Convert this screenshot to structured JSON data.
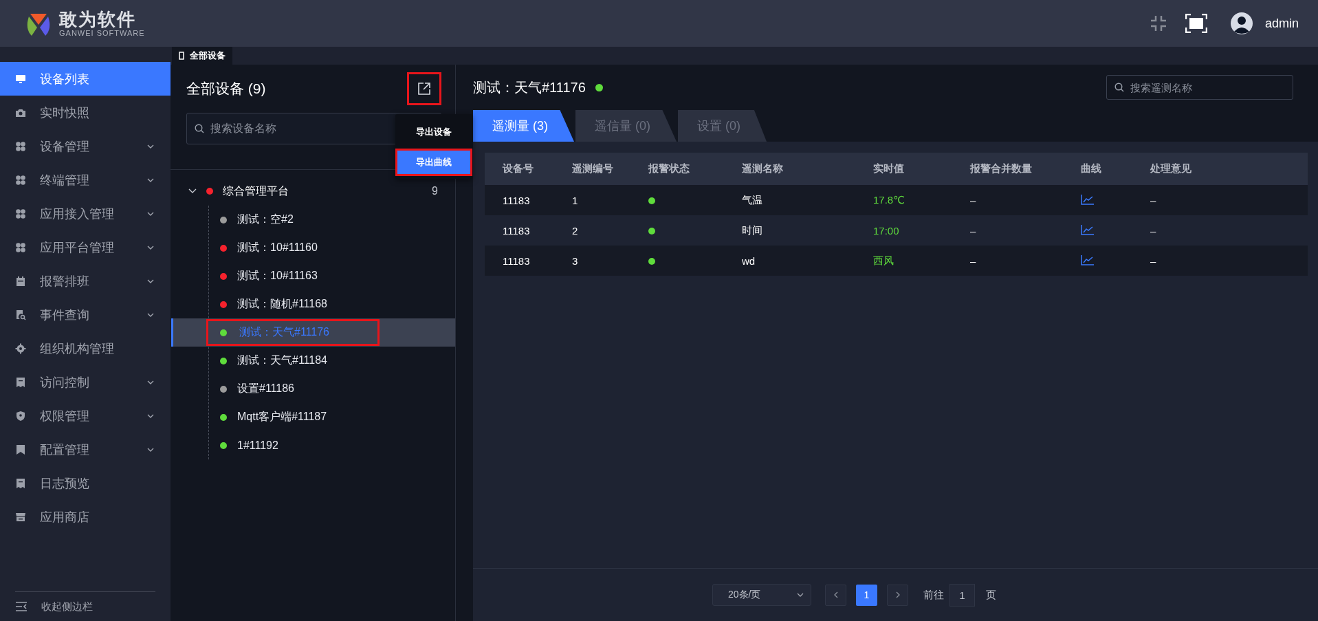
{
  "header": {
    "logo_title": "敢为软件",
    "logo_subtitle": "GANWEI SOFTWARE",
    "user": "admin"
  },
  "sidebar": {
    "items": [
      {
        "label": "设备列表",
        "selected": true,
        "expandable": false
      },
      {
        "label": "实时快照",
        "selected": false,
        "expandable": false
      },
      {
        "label": "设备管理",
        "selected": false,
        "expandable": true
      },
      {
        "label": "终端管理",
        "selected": false,
        "expandable": true
      },
      {
        "label": "应用接入管理",
        "selected": false,
        "expandable": true
      },
      {
        "label": "应用平台管理",
        "selected": false,
        "expandable": true
      },
      {
        "label": "报警排班",
        "selected": false,
        "expandable": true
      },
      {
        "label": "事件查询",
        "selected": false,
        "expandable": true
      },
      {
        "label": "组织机构管理",
        "selected": false,
        "expandable": false
      },
      {
        "label": "访问控制",
        "selected": false,
        "expandable": true
      },
      {
        "label": "权限管理",
        "selected": false,
        "expandable": true
      },
      {
        "label": "配置管理",
        "selected": false,
        "expandable": true
      },
      {
        "label": "日志预览",
        "selected": false,
        "expandable": false
      },
      {
        "label": "应用商店",
        "selected": false,
        "expandable": false
      }
    ],
    "collapse": "收起侧边栏"
  },
  "page_tabs": [
    {
      "label": "全部设备",
      "selected": true
    }
  ],
  "device_panel": {
    "title": "全部设备 (9)",
    "export_highlighted": true,
    "export_menu": [
      {
        "label": "导出设备",
        "selected": false,
        "highlighted": false
      },
      {
        "label": "导出曲线",
        "selected": true,
        "highlighted": true
      }
    ],
    "search": {
      "placeholder": "搜索设备名称"
    },
    "tree": [
      {
        "label": "综合管理平台",
        "color": "#f5222d",
        "count": "9",
        "expanded": true,
        "children": [
          {
            "label": "测试：空#2",
            "color": "#9b9b9b",
            "selected": false,
            "highlighted": false
          },
          {
            "label": "测试：10#11160",
            "color": "#f5222d",
            "selected": false,
            "highlighted": false
          },
          {
            "label": "测试：10#11163",
            "color": "#f5222d",
            "selected": false,
            "highlighted": false
          },
          {
            "label": "测试：随机#11168",
            "color": "#f5222d",
            "selected": false,
            "highlighted": false
          },
          {
            "label": "测试：天气#11176",
            "color": "#5fdc3c",
            "selected": true,
            "highlighted": true
          },
          {
            "label": "测试：天气#11184",
            "color": "#5fdc3c",
            "selected": false,
            "highlighted": false
          },
          {
            "label": "设置#11186",
            "color": "#9b9b9b",
            "selected": false,
            "highlighted": false
          },
          {
            "label": "Mqtt客户端#11187",
            "color": "#5fdc3c",
            "selected": false,
            "highlighted": false
          },
          {
            "label": "1#11192",
            "color": "#5fdc3c",
            "selected": false,
            "highlighted": false
          }
        ]
      }
    ]
  },
  "detail": {
    "title": "测试：天气#11176",
    "color": "#5fdc3c",
    "search": {
      "placeholder": "搜索遥测名称"
    },
    "tabs": [
      {
        "label": "遥测量 (3)",
        "selected": true
      },
      {
        "label": "遥信量 (0)",
        "selected": false
      },
      {
        "label": "设置 (0)",
        "selected": false
      }
    ],
    "table": {
      "columns": [
        "设备号",
        "遥测编号",
        "报警状态",
        "遥测名称",
        "实时值",
        "报警合并数量",
        "曲线",
        "处理意见"
      ],
      "rows": [
        {
          "device": "11183",
          "number": "1",
          "color": "#5fdc3c",
          "name": "气温",
          "value": "17.8℃",
          "merged": "–",
          "opinion": "–"
        },
        {
          "device": "11183",
          "number": "2",
          "color": "#5fdc3c",
          "name": "时间",
          "value": "17:00",
          "merged": "–",
          "opinion": "–"
        },
        {
          "device": "11183",
          "number": "3",
          "color": "#5fdc3c",
          "name": "wd",
          "value": "西风",
          "merged": "–",
          "opinion": "–"
        }
      ]
    },
    "pagination": {
      "page_size": "20条/页",
      "pages": [
        {
          "label": "1",
          "selected": true
        }
      ],
      "goto_label": "前往",
      "goto_value": "1",
      "page_unit": "页"
    }
  }
}
